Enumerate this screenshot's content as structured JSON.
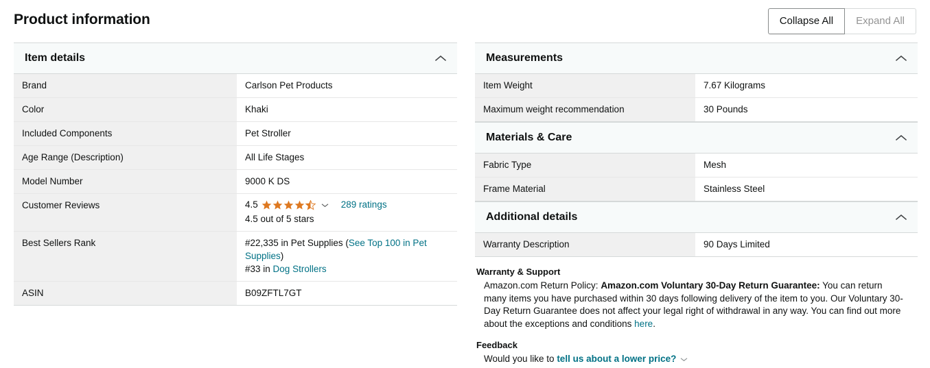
{
  "header": {
    "title": "Product information",
    "collapse_all_label": "Collapse All",
    "expand_all_label": "Expand All"
  },
  "colors": {
    "link": "#007185",
    "star": "#DE7921",
    "section_bg": "#F7FAFA",
    "key_bg": "#F0F0F0",
    "border": "#D5D9D9"
  },
  "left_column": {
    "section": {
      "title": "Item details",
      "collapse_icon": "chevron-up-icon",
      "expanded": true
    },
    "rows": [
      {
        "key": "Brand",
        "value": "Carlson Pet Products"
      },
      {
        "key": "Color",
        "value": "Khaki"
      },
      {
        "key": "Included Components",
        "value": "Pet Stroller"
      },
      {
        "key": "Age Range (Description)",
        "value": "All Life Stages"
      },
      {
        "key": "Model Number",
        "value": "9000 K DS"
      }
    ],
    "customer_reviews": {
      "key": "Customer Reviews",
      "rating_value": "4.5",
      "stars_filled": 4.5,
      "stars_total": 5,
      "dropdown_icon": "chevron-down-icon",
      "ratings_count_label": "289 ratings",
      "out_of_label": "4.5 out of 5 stars"
    },
    "best_sellers_rank": {
      "key": "Best Sellers Rank",
      "line1_prefix": "#22,335 in Pet Supplies (",
      "line1_link": "See Top 100 in Pet Supplies",
      "line1_suffix": ")",
      "line2_prefix": "#33 in ",
      "line2_link": "Dog Strollers"
    },
    "asin": {
      "key": "ASIN",
      "value": "B09ZFTL7GT"
    }
  },
  "right_column": {
    "sections": [
      {
        "title": "Measurements",
        "collapse_icon": "chevron-up-icon",
        "expanded": true,
        "rows": [
          {
            "key": "Item Weight",
            "value": "7.67 Kilograms"
          },
          {
            "key": "Maximum weight recommendation",
            "value": "30 Pounds"
          }
        ]
      },
      {
        "title": "Materials & Care",
        "collapse_icon": "chevron-up-icon",
        "expanded": true,
        "rows": [
          {
            "key": "Fabric Type",
            "value": "Mesh"
          },
          {
            "key": "Frame Material",
            "value": "Stainless Steel"
          }
        ]
      },
      {
        "title": "Additional details",
        "collapse_icon": "chevron-up-icon",
        "expanded": true,
        "rows": [
          {
            "key": "Warranty Description",
            "value": "90 Days Limited"
          }
        ]
      }
    ],
    "warranty": {
      "heading": "Warranty & Support",
      "text_prefix": "Amazon.com Return Policy: ",
      "text_bold": "Amazon.com Voluntary 30-Day Return Guarantee:",
      "text_body": " You can return many items you have purchased within 30 days following delivery of the item to you. Our Voluntary 30-Day Return Guarantee does not affect your legal right of withdrawal in any way. You can find out more about the exceptions and conditions ",
      "link_label": "here",
      "text_suffix": "."
    },
    "feedback": {
      "heading": "Feedback",
      "prompt_prefix": "Would you like to ",
      "link_label": "tell us about a lower price?",
      "chevron_icon": "chevron-down-icon"
    }
  }
}
